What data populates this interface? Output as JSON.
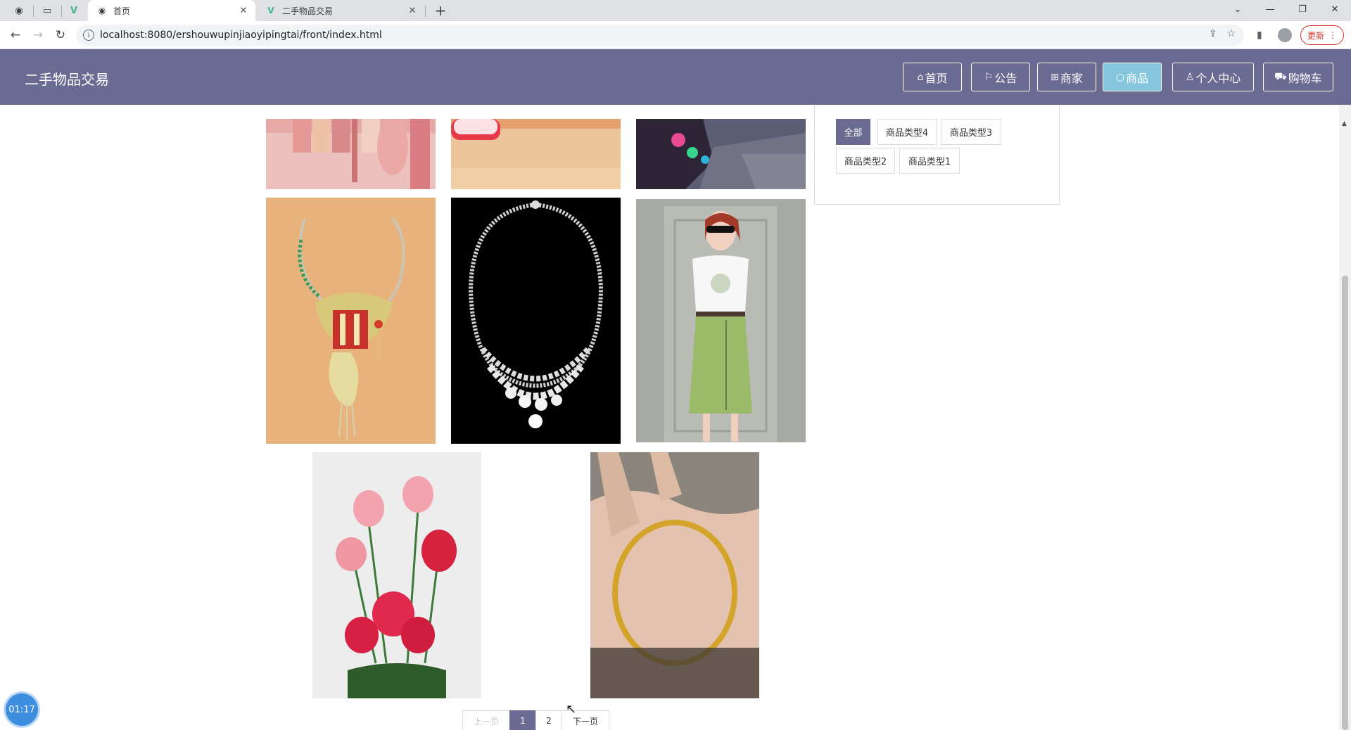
{
  "browser": {
    "tabs": [
      {
        "title": "首页",
        "active": true
      },
      {
        "title": "二手物品交易",
        "active": false
      }
    ],
    "url": "localhost:8080/ershouwupinjiaoyipingtai/front/index.html",
    "update_label": "更新"
  },
  "site": {
    "brand": "二手物品交易",
    "nav": [
      {
        "icon": "home-icon",
        "label": "首页",
        "active": false
      },
      {
        "icon": "flag-icon",
        "label": "公告",
        "active": false
      },
      {
        "icon": "gift-icon",
        "label": "商家",
        "active": false
      },
      {
        "icon": "circle-icon",
        "label": "商品",
        "active": true
      },
      {
        "icon": "user-icon",
        "label": "个人中心",
        "active": false
      },
      {
        "icon": "cart-icon",
        "label": "购物车",
        "active": false
      }
    ]
  },
  "filter": {
    "categories": [
      {
        "label": "全部",
        "active": true
      },
      {
        "label": "商品类型4",
        "active": false
      },
      {
        "label": "商品类型3",
        "active": false
      },
      {
        "label": "商品类型2",
        "active": false
      },
      {
        "label": "商品类型1",
        "active": false
      }
    ]
  },
  "products": [
    {
      "image": "cosmetics-palette"
    },
    {
      "image": "red-box"
    },
    {
      "image": "phone-in-hand"
    },
    {
      "image": "gold-necklace"
    },
    {
      "image": "diamond-necklace"
    },
    {
      "image": "model-green-skirt"
    },
    {
      "image": "pink-red-roses"
    },
    {
      "image": "gold-bangle"
    }
  ],
  "pagination": {
    "prev": "上一页",
    "pages": [
      "1",
      "2"
    ],
    "current": "1",
    "next": "下一页"
  },
  "overlay": {
    "timer": "01:17"
  }
}
